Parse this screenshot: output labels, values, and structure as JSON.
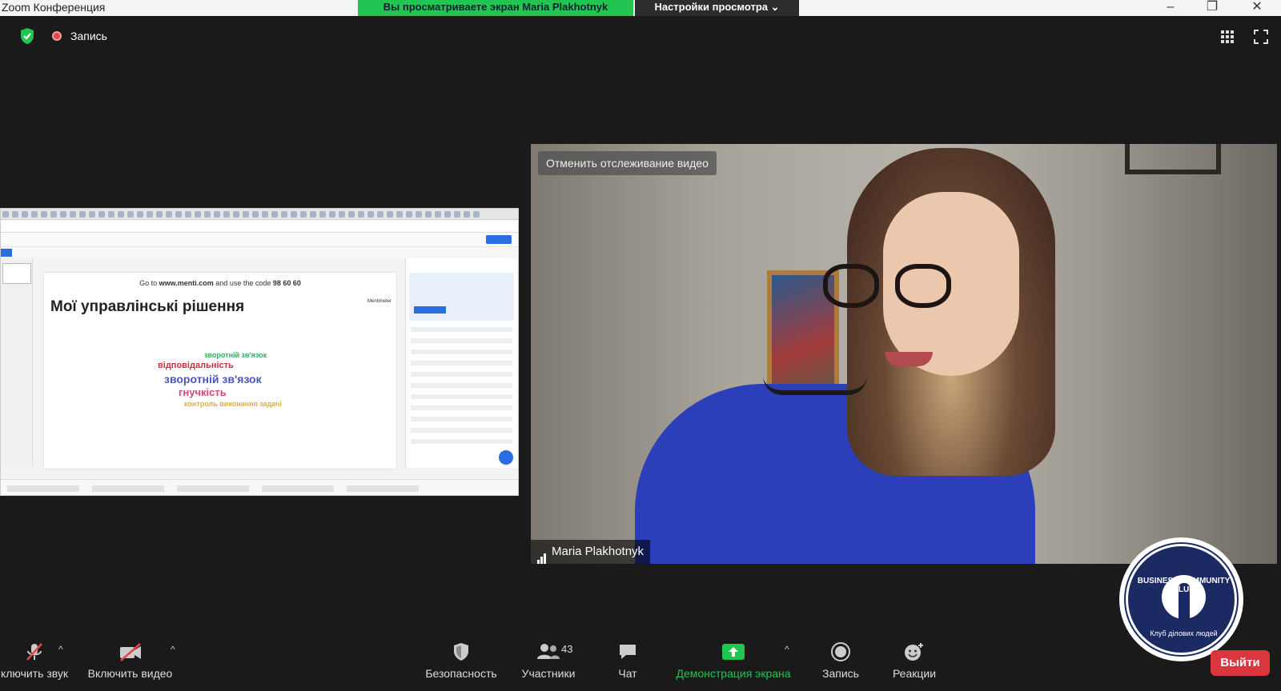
{
  "window": {
    "title": "Zoom Конференция",
    "viewing_banner": "Вы просматриваете экран Maria Plakhotnyk",
    "view_options": "Настройки просмотра"
  },
  "status": {
    "recording_label": "Запись"
  },
  "shared_screen": {
    "slide_goto_prefix": "Go to ",
    "slide_goto_url": "www.menti.com",
    "slide_goto_mid": " and use the code ",
    "slide_goto_code": "98 60 60",
    "slide_title": "Мої управлінські рішення",
    "brand": "Mentimeter",
    "word_cloud": [
      "зворотній зв'язок",
      "відповідальність",
      "зворотній зв'язок",
      "гнучкість",
      "контроль виконання задачі"
    ]
  },
  "video": {
    "unfollow_label": "Отменить отслеживание видео",
    "participant_name": "Maria Plakhotnyk"
  },
  "logo": {
    "top_text": "BUSINESS COMMUNITY CLUB",
    "bottom_text": "Клуб ділових людей"
  },
  "toolbar": {
    "mute_label": "ключить звук",
    "video_label": "Включить видео",
    "security_label": "Безопасность",
    "participants_label": "Участники",
    "participants_count": "43",
    "chat_label": "Чат",
    "share_label": "Демонстрация экрана",
    "record_label": "Запись",
    "reactions_label": "Реакции",
    "leave_label": "Выйти"
  },
  "colors": {
    "banner_green": "#23c552",
    "leave_red": "#d9363e",
    "background": "#1a1a1a"
  }
}
